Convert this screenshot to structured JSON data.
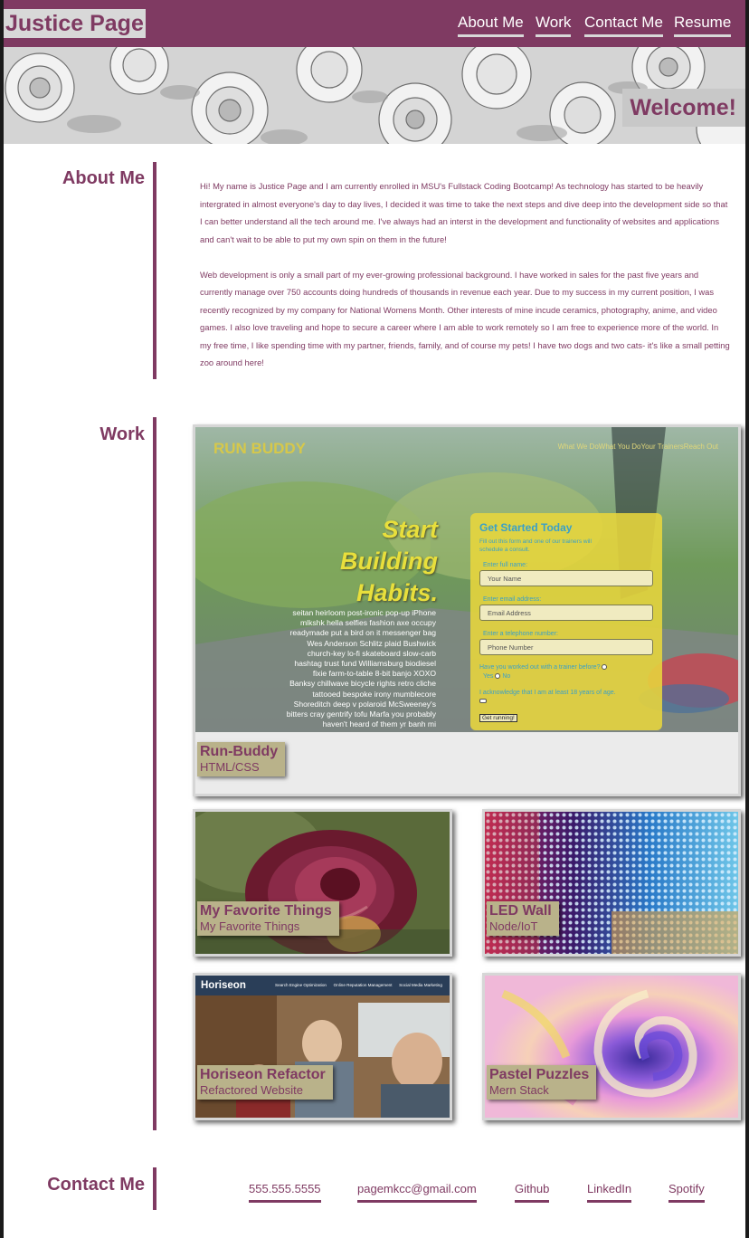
{
  "header": {
    "brand": "Justice Page",
    "nav": [
      "About Me",
      "Work",
      "Contact Me",
      "Resume"
    ]
  },
  "hero": {
    "welcome": "Welcome!"
  },
  "about": {
    "title": "About Me",
    "paragraphs": [
      "Hi! My name is Justice Page and I am currently enrolled in MSU's Fullstack Coding Bootcamp! As technology has started to be heavily intergrated in almost everyone's day to day lives, I decided it was time to take the next steps and dive deep into the development side so that I can better understand all the tech around me. I've always had an interst in the development and functionality of websites and applications and can't wait to be able to put my own spin on them in the future!",
      "Web development is only a small part of my ever-growing professional background. I have worked in sales for the past five years and currently manage over 750 accounts doing hundreds of thousands in revenue each year. Due to my success in my current position, I was recently recognized by my company for National Womens Month. Other interests of mine incude ceramics, photography, anime, and video games. I also love traveling and hope to secure a career where I am able to work remotely so I am free to experience more of the world. In my free time, I like spending time with my partner, friends, family, and of course my pets! I have two dogs and two cats- it's like a small petting zoo around here!"
    ]
  },
  "work": {
    "title": "Work",
    "featured": {
      "title": "Run-Buddy",
      "subtitle": "HTML/CSS",
      "screenshot": {
        "logo": "RUN BUDDY",
        "nav": "What We DoWhat You DoYour TrainersReach Out",
        "headline": [
          "Start",
          "Building",
          "Habits."
        ],
        "lorem": [
          "seitan heirloom post-ironic pop-up iPhone",
          "mlkshk hella selfies fashion axe occupy",
          "readymade put a bird on it messenger bag",
          "Wes Anderson Schlitz plaid Bushwick",
          "church-key lo-fi skateboard slow-carb",
          "hashtag trust fund Williamsburg biodiesel",
          "fixie farm-to-table 8-bit banjo XOXO",
          "Banksy chillwave bicycle rights retro cliche",
          "tattooed bespoke irony mumblecore",
          "Shoreditch deep v polaroid McSweeney's",
          "bitters cray gentrify tofu Marfa you probably",
          "haven't heard of them yr banh mi"
        ],
        "form_title": "Get Started Today",
        "form_intro": [
          "Fill out this form and one of our trainers will",
          "schedule a consult."
        ],
        "label_name": "Enter full name:",
        "placeholder_name": "Your Name",
        "label_email": "Enter email address:",
        "placeholder_email": "Email Address",
        "label_phone": "Enter a telephone number:",
        "placeholder_phone": "Phone Number",
        "question": "Have you worked out with a trainer before?",
        "yes": "Yes",
        "no": "No",
        "acknowledge": "I acknowledge that I am at least 18 years of age.",
        "submit": "Get running!"
      }
    },
    "projects": [
      {
        "title": "My Favorite Things",
        "subtitle": "My Favorite Things"
      },
      {
        "title": "LED Wall",
        "subtitle": "Node/IoT"
      },
      {
        "title": "Horiseon Refactor",
        "subtitle": "Refactored Website",
        "screenshot": {
          "logo": "Horiseon",
          "nav": [
            "Search Engine Optimization",
            "Online Reputation Management",
            "Social Media Marketing"
          ]
        }
      },
      {
        "title": "Pastel Puzzles",
        "subtitle": "Mern Stack"
      }
    ]
  },
  "contact": {
    "title": "Contact Me",
    "links": [
      "555.555.5555",
      "pagemkcc@gmail.com",
      "Github",
      "LinkedIn",
      "Spotify"
    ]
  },
  "colors": {
    "accent": "#7f3a62",
    "label_bg": "#b9b28a",
    "brand_bg": "#d8d8d8"
  }
}
